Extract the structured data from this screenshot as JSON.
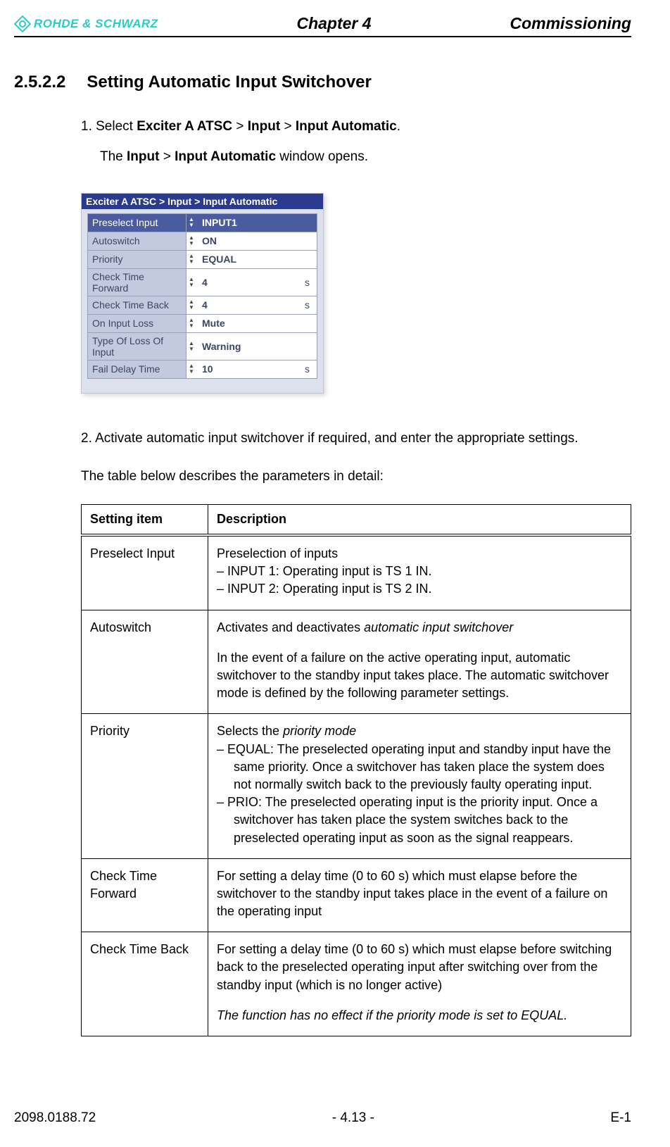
{
  "header": {
    "brand": "ROHDE & SCHWARZ",
    "chapter": "Chapter 4",
    "title": "Commissioning"
  },
  "section": {
    "number": "2.5.2.2",
    "title": "Setting Automatic Input Switchover"
  },
  "steps": {
    "s1_prefix": "1.  Select ",
    "s1_b1": "Exciter A ATSC",
    "s1_gt1": " > ",
    "s1_b2": "Input",
    "s1_gt2": " > ",
    "s1_b3": "Input Automatic",
    "s1_suffix": ".",
    "s1_result_pre": "The ",
    "s1_result_b1": "Input",
    "s1_result_gt": " > ",
    "s1_result_b2": "Input Automatic",
    "s1_result_post": " window opens.",
    "s2": "2.  Activate automatic input switchover if required, and enter the appropriate settings."
  },
  "config": {
    "breadcrumb": "Exciter A ATSC  > Input > Input Automatic",
    "rows": [
      {
        "label": "Preselect Input",
        "value": "INPUT1",
        "unit": "",
        "highlight": true
      },
      {
        "label": "Autoswitch",
        "value": "ON",
        "unit": "",
        "highlight": false
      },
      {
        "label": "Priority",
        "value": "EQUAL",
        "unit": "",
        "highlight": false
      },
      {
        "label": "Check Time Forward",
        "value": "4",
        "unit": "s",
        "highlight": false
      },
      {
        "label": "Check Time Back",
        "value": "4",
        "unit": "s",
        "highlight": false
      },
      {
        "label": "On Input Loss",
        "value": "Mute",
        "unit": "",
        "highlight": false
      },
      {
        "label": "Type Of Loss Of Input",
        "value": "Warning",
        "unit": "",
        "highlight": false
      },
      {
        "label": "Fail Delay Time",
        "value": "10",
        "unit": "s",
        "highlight": false
      }
    ]
  },
  "table_intro": "The table below describes the parameters in detail:",
  "desc_table": {
    "h1": "Setting item",
    "h2": "Description",
    "rows": {
      "r1_item": "Preselect Input",
      "r1_desc_l1": "Preselection of inputs",
      "r1_desc_b1": "INPUT 1: Operating input is TS 1 IN.",
      "r1_desc_b2": "INPUT 2: Operating input is TS 2 IN.",
      "r2_item": "Autoswitch",
      "r2_desc_l1a": "Activates and deactivates ",
      "r2_desc_l1b": "automatic input switchover",
      "r2_desc_p2": "In the event of a failure on the active operating input, automatic switchover to the standby input takes place. The automatic switchover mode is defined by the following parameter settings.",
      "r3_item": "Priority",
      "r3_desc_l1a": "Selects the ",
      "r3_desc_l1b": "priority mode",
      "r3_desc_b1": "EQUAL: The preselected operating input and standby input have the same priority. Once a switchover has taken place the system does not normally switch back to the previously faulty operating input.",
      "r3_desc_b2": "PRIO: The preselected operating input is the priority input. Once a switchover has taken place the system switches back to the preselected operating input as soon as the signal reappears.",
      "r4_item": "Check Time Forward",
      "r4_desc": "For setting a delay time (0 to 60 s) which must elapse before the switchover to the standby input takes place in the event of a failure on the operating input",
      "r5_item": "Check Time Back",
      "r5_desc_p1": "For setting a delay time (0 to 60 s) which must elapse before switching back to the preselected operating input after switching over from the standby input (which is no longer active)",
      "r5_desc_p2": "The function has no effect if the priority mode is set to EQUAL."
    }
  },
  "footer": {
    "left": "2098.0188.72",
    "center": "- 4.13 -",
    "right": "E-1"
  }
}
